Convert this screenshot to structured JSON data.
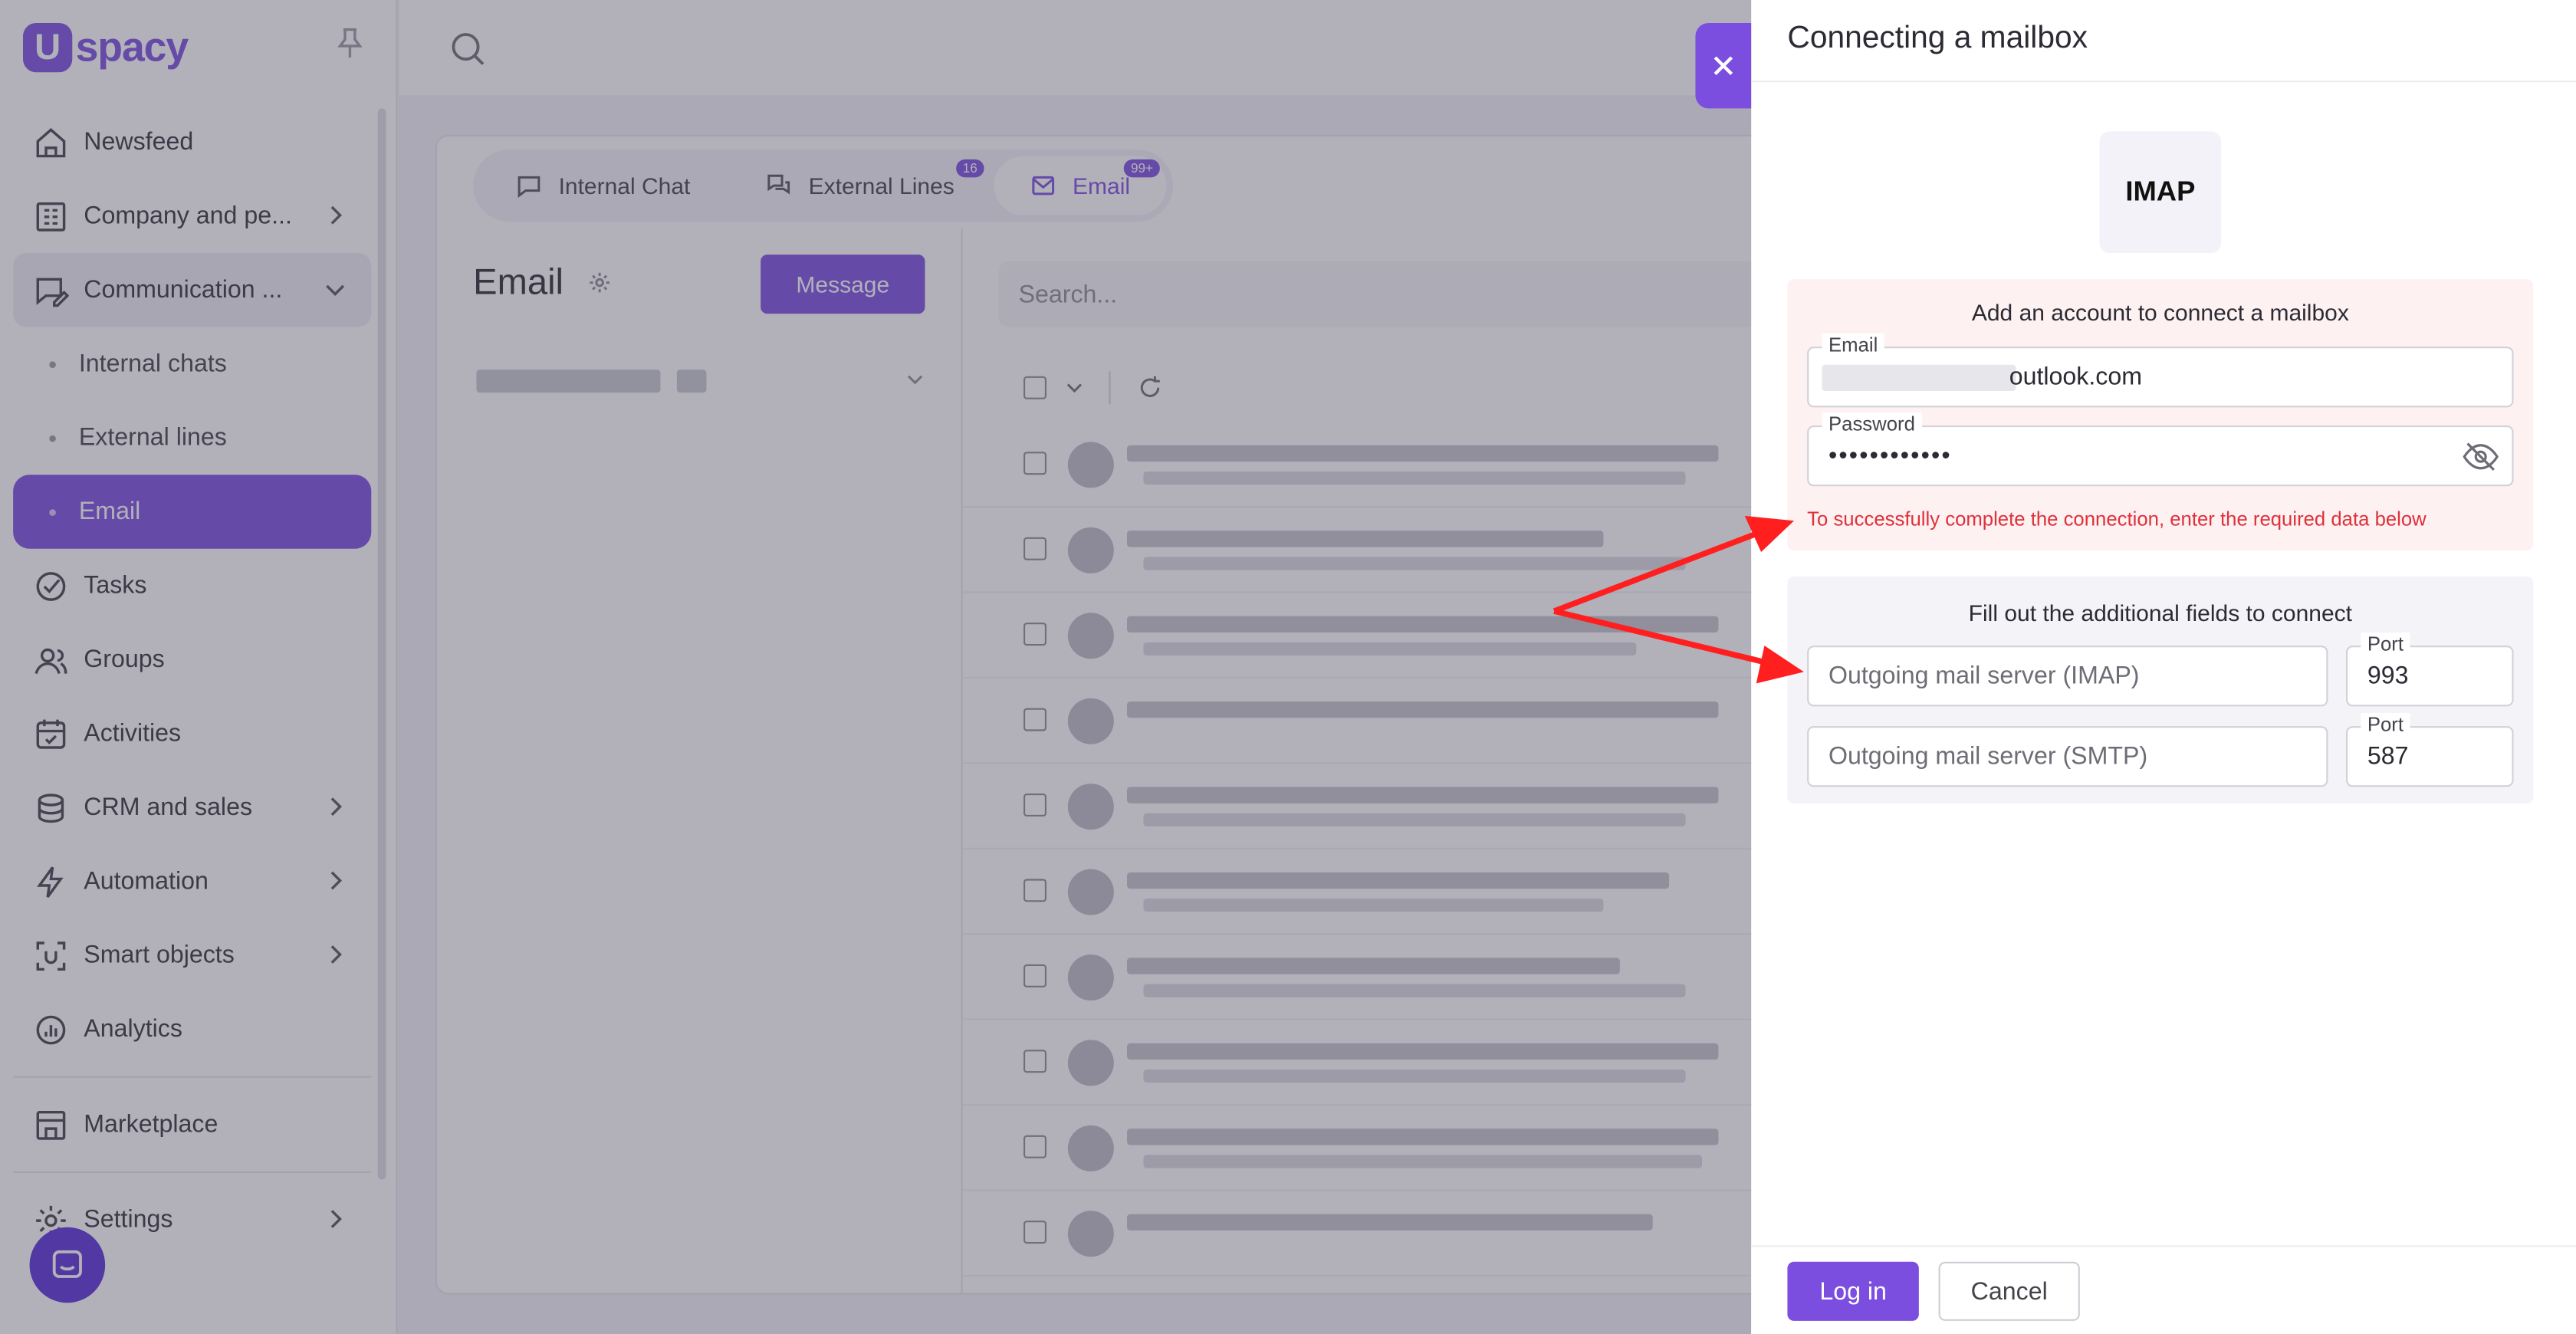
{
  "brand": {
    "logo_letter": "U",
    "logo_text": "spacy",
    "accent": "#7b4ee0"
  },
  "sidebar": {
    "items": [
      {
        "label": "Newsfeed",
        "icon": "home-icon"
      },
      {
        "label": "Company and pe...",
        "icon": "building-icon"
      },
      {
        "label": "Communication ...",
        "icon": "chat-edit-icon"
      },
      {
        "label": "Internal chats"
      },
      {
        "label": "External lines"
      },
      {
        "label": "Email"
      },
      {
        "label": "Tasks",
        "icon": "check-circle-icon"
      },
      {
        "label": "Groups",
        "icon": "users-icon"
      },
      {
        "label": "Activities",
        "icon": "calendar-icon"
      },
      {
        "label": "CRM and sales",
        "icon": "coins-icon"
      },
      {
        "label": "Automation",
        "icon": "lightning-icon"
      },
      {
        "label": "Smart objects",
        "icon": "scan-icon"
      },
      {
        "label": "Analytics",
        "icon": "chart-icon"
      },
      {
        "label": "Marketplace",
        "icon": "store-icon"
      },
      {
        "label": "Settings",
        "icon": "gear-icon"
      }
    ]
  },
  "main": {
    "tabs": [
      {
        "label": "Internal Chat",
        "badge": ""
      },
      {
        "label": "External Lines",
        "badge": "16"
      },
      {
        "label": "Email",
        "badge": "99+"
      }
    ],
    "title": "Email",
    "message_button": "Message",
    "search_placeholder": "Search..."
  },
  "drawer": {
    "title": "Connecting a mailbox",
    "protocol": "IMAP",
    "account_caption": "Add an account to connect a mailbox",
    "email_label": "Email",
    "email_value_visible": "outlook.com",
    "password_label": "Password",
    "password_mask": "••••••••••••",
    "error": "To successfully complete the connection, enter the required data below",
    "extra_caption": "Fill out the additional fields to connect",
    "imap_placeholder": "Outgoing mail server (IMAP)",
    "smtp_placeholder": "Outgoing mail server (SMTP)",
    "port_label": "Port",
    "imap_port": "993",
    "smtp_port": "587",
    "login_button": "Log in",
    "cancel_button": "Cancel"
  },
  "colors": {
    "error": "#e0303a",
    "annotation_arrow": "#ff1f1f",
    "warning_bg": "#fdf1f1"
  }
}
